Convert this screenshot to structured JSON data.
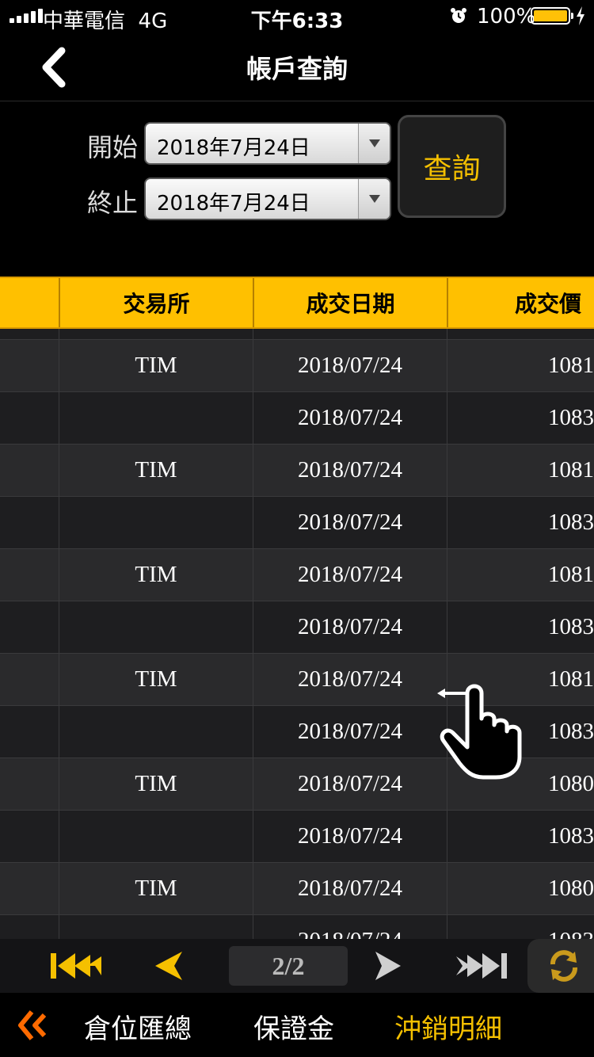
{
  "status": {
    "carrier": "中華電信",
    "network": "4G",
    "time": "下午6:33",
    "battery": "100%"
  },
  "nav": {
    "title": "帳戶查詢",
    "back_icon": "chevron-left-icon"
  },
  "query": {
    "start_label": "開始",
    "start_value": "2018年7月24日",
    "end_label": "終止",
    "end_value": "2018年7月24日",
    "button_label": "查詢"
  },
  "table": {
    "headers": [
      "交易所",
      "成交日期",
      "成交價"
    ],
    "rows": [
      {
        "exchange": "TIM",
        "date": "2018/07/24",
        "price": "1081"
      },
      {
        "exchange": "",
        "date": "2018/07/24",
        "price": "1083"
      },
      {
        "exchange": "TIM",
        "date": "2018/07/24",
        "price": "1081"
      },
      {
        "exchange": "",
        "date": "2018/07/24",
        "price": "1083"
      },
      {
        "exchange": "TIM",
        "date": "2018/07/24",
        "price": "1081"
      },
      {
        "exchange": "",
        "date": "2018/07/24",
        "price": "1083"
      },
      {
        "exchange": "TIM",
        "date": "2018/07/24",
        "price": "1081"
      },
      {
        "exchange": "",
        "date": "2018/07/24",
        "price": "1083"
      },
      {
        "exchange": "TIM",
        "date": "2018/07/24",
        "price": "1080"
      },
      {
        "exchange": "",
        "date": "2018/07/24",
        "price": "1083"
      },
      {
        "exchange": "TIM",
        "date": "2018/07/24",
        "price": "1080"
      },
      {
        "exchange": "",
        "date": "2018/07/24",
        "price": "1083"
      }
    ]
  },
  "pager": {
    "page": "2/2",
    "accent": "#f5c000"
  },
  "tabs": {
    "items": [
      "倉位匯總",
      "保證金",
      "沖銷明細"
    ],
    "active": "沖銷明細"
  },
  "colors": {
    "header_bg": "#ffc000",
    "active_tab": "#f5c000",
    "back_arrow": "#ff6a00"
  }
}
